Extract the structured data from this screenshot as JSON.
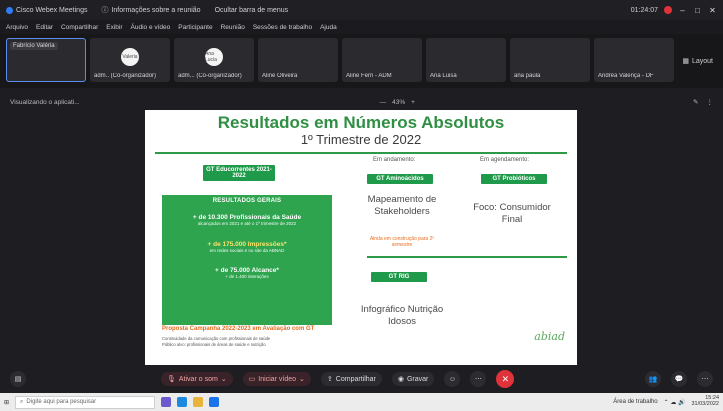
{
  "titlebar": {
    "app_title": "Cisco Webex Meetings",
    "info_label": "Informações sobre a reunião",
    "extra": "Ocultar barra de menus",
    "time": "01:24:07"
  },
  "menubar": [
    "Arquivo",
    "Editar",
    "Compartilhar",
    "Exibir",
    "Áudio e vídeo",
    "Participante",
    "Reunião",
    "Sessões de trabalho",
    "Ajuda"
  ],
  "participants": [
    {
      "name_tag": "Fabrício Valéria",
      "label": ""
    },
    {
      "avatar": "Valeria",
      "label": "adm.. (Co-organizador)"
    },
    {
      "avatar": "Ana Lucia",
      "label": "adm... (Co-organizador)"
    },
    {
      "label": "Aline Oliveira"
    },
    {
      "label": "Aline Ferri - ADM"
    },
    {
      "label": "Ana Luisa"
    },
    {
      "label": "ana paula"
    },
    {
      "label": "Andréa Valença - DF"
    }
  ],
  "layout_label": "Layout",
  "viewbar": {
    "left": "Visualizando o aplicati...",
    "zoom": "43%"
  },
  "slide": {
    "title": "Resultados em Números Absolutos",
    "subtitle": "1º Trimestre de 2022",
    "gt_educ": "GT Educorrentes 2021-2022",
    "results_header": "RESULTADOS GERAIS",
    "r1_big": "+ de 10.300 Profissionais da Saúde",
    "r1_small": "alcançados em 2021 e até o 1º trimestre de 2022",
    "r2_big": "+ de 175.000 Impressões*",
    "r2_small": "em redes sociais e no site da ABNAD",
    "r3_big": "+ de 75.000 Alcance*",
    "r3_small": "+ de 1.400 interações",
    "proposta": "Proposta Campanha 2022-2023 em Avaliação com GT",
    "proposta_line1": "Continuidade da comunicação com profissionais de saúde",
    "proposta_line2": "Público alvo: profissionais de áreas de saúde e nutrição",
    "em_andamento": "Em andamento:",
    "gt_amino": "GT Aminoácidos",
    "mapeamento": "Mapeamento de Stakeholders",
    "orange_note": "Ainda em construção para 2º semestre",
    "em_agendamento": "Em agendamento:",
    "gt_probi": "GT Probióticos",
    "foco": "Foco: Consumidor Final",
    "gt_rig": "GT RIG",
    "infografico": "Infográfico Nutrição Idosos",
    "logo": "abiad"
  },
  "controls": {
    "mute": "Ativar o som",
    "video": "Iniciar vídeo",
    "share": "Compartilhar",
    "record": "Gravar"
  },
  "taskbar": {
    "search": "Digite aqui para pesquisar",
    "area": "Área de trabalho",
    "time": "15:24",
    "date": "31/03/2022"
  }
}
